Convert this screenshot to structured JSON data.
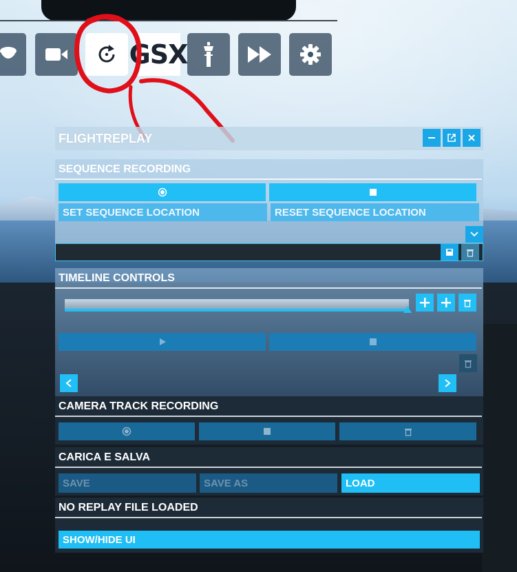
{
  "toolbar": {
    "buttons": [
      {
        "icon": "pilot-hat-icon"
      },
      {
        "icon": "camera-icon"
      },
      {
        "icon": "replay-icon",
        "active": true
      },
      {
        "label": "GSX"
      },
      {
        "icon": "control-tower-icon"
      },
      {
        "icon": "fast-forward-icon"
      },
      {
        "icon": "gear-icon"
      }
    ]
  },
  "panel": {
    "title": "FLIGHTREPLAY",
    "window_buttons": [
      "minimize-icon",
      "popout-icon",
      "close-icon"
    ]
  },
  "sequence_recording": {
    "title": "SEQUENCE RECORDING",
    "set_location": "SET SEQUENCE LOCATION",
    "reset_location": "RESET SEQUENCE LOCATION"
  },
  "timeline": {
    "title": "TIMELINE CONTROLS",
    "progress": 1.0
  },
  "camera_track": {
    "title": "CAMERA TRACK RECORDING"
  },
  "load_save": {
    "title": "CARICA E SALVA",
    "save": "SAVE",
    "save_as": "SAVE AS",
    "load": "LOAD"
  },
  "file_status": {
    "title": "NO REPLAY FILE LOADED",
    "show_hide": "SHOW/HIDE UI"
  },
  "colors": {
    "accent": "#21bff5",
    "annotation": "#e0101a"
  }
}
